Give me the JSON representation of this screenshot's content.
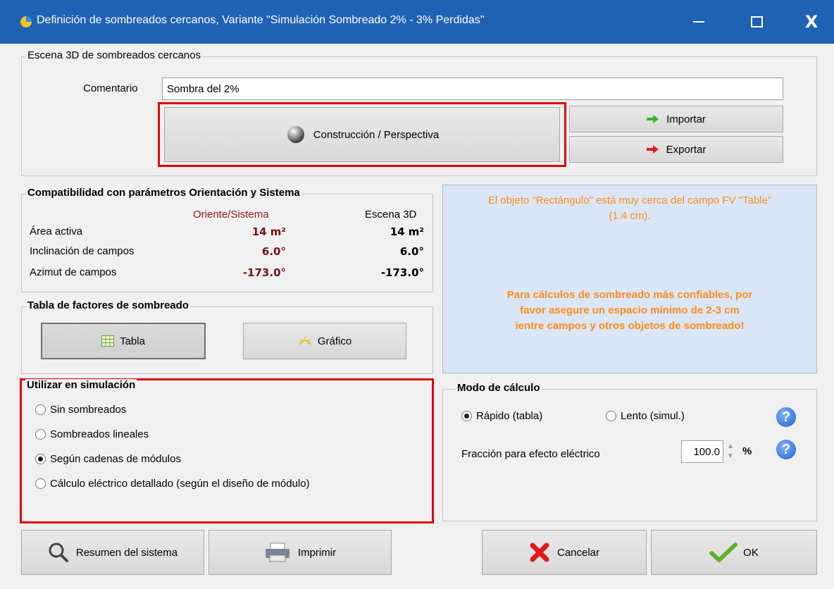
{
  "window": {
    "title": "Definición de sombreados cercanos, Variante \"Simulación Sombreado 2% - 3% Perdidas\"",
    "minimize": "—",
    "maximize": "□",
    "close": "X"
  },
  "scene": {
    "legend": "Escena 3D de sombreados cercanos",
    "comment_label": "Comentario",
    "comment_value": "Sombra del 2%",
    "construction_button": "Construcción / Perspectiva",
    "import_button": "Importar",
    "export_button": "Exportar"
  },
  "compat": {
    "legend": "Compatibilidad con parámetros Orientación y Sistema",
    "col_orient": "Oriente/Sistema",
    "col_scene": "Escena 3D",
    "rows": [
      {
        "label": "Área activa",
        "orient": "14 m²",
        "scene": "14 m²"
      },
      {
        "label": "Inclinación de campos",
        "orient": "6.0°",
        "scene": "6.0°"
      },
      {
        "label": "Azimut de campos",
        "orient": "-173.0°",
        "scene": "-173.0°"
      }
    ]
  },
  "factors": {
    "legend": "Tabla de factores de sombreado",
    "table_button": "Tabla",
    "graph_button": "Gráfico"
  },
  "warning": {
    "line1": "El objeto \"Rectángulo\" está muy cerca del campo FV \"Table\"",
    "line2": "(1.4 cm).",
    "bold1": "Para cálculos de sombreado más confiables, por",
    "bold2": "favor asegure un espacio mínimo de 2-3 cm",
    "bold3": "ientre campos y otros objetos de sombreado!"
  },
  "simulation": {
    "legend": "Utilizar en simulación",
    "options": [
      "Sin sombreados",
      "Sombreados lineales",
      "Según cadenas de módulos",
      "Cálculo eléctrico detallado (según el diseño de módulo)"
    ],
    "selected": 2
  },
  "calc_mode": {
    "legend": "Modo de cálculo",
    "fast": "Rápido (tabla)",
    "slow": "Lento (simul.)",
    "selected": "fast",
    "fraction_label": "Fracción para efecto eléctrico",
    "fraction_value": "100.0",
    "fraction_unit": "%",
    "help": "?"
  },
  "footer": {
    "summary_button": "Resumen del sistema",
    "print_button": "Imprimir",
    "cancel_button": "Cancelar",
    "ok_button": "OK"
  }
}
